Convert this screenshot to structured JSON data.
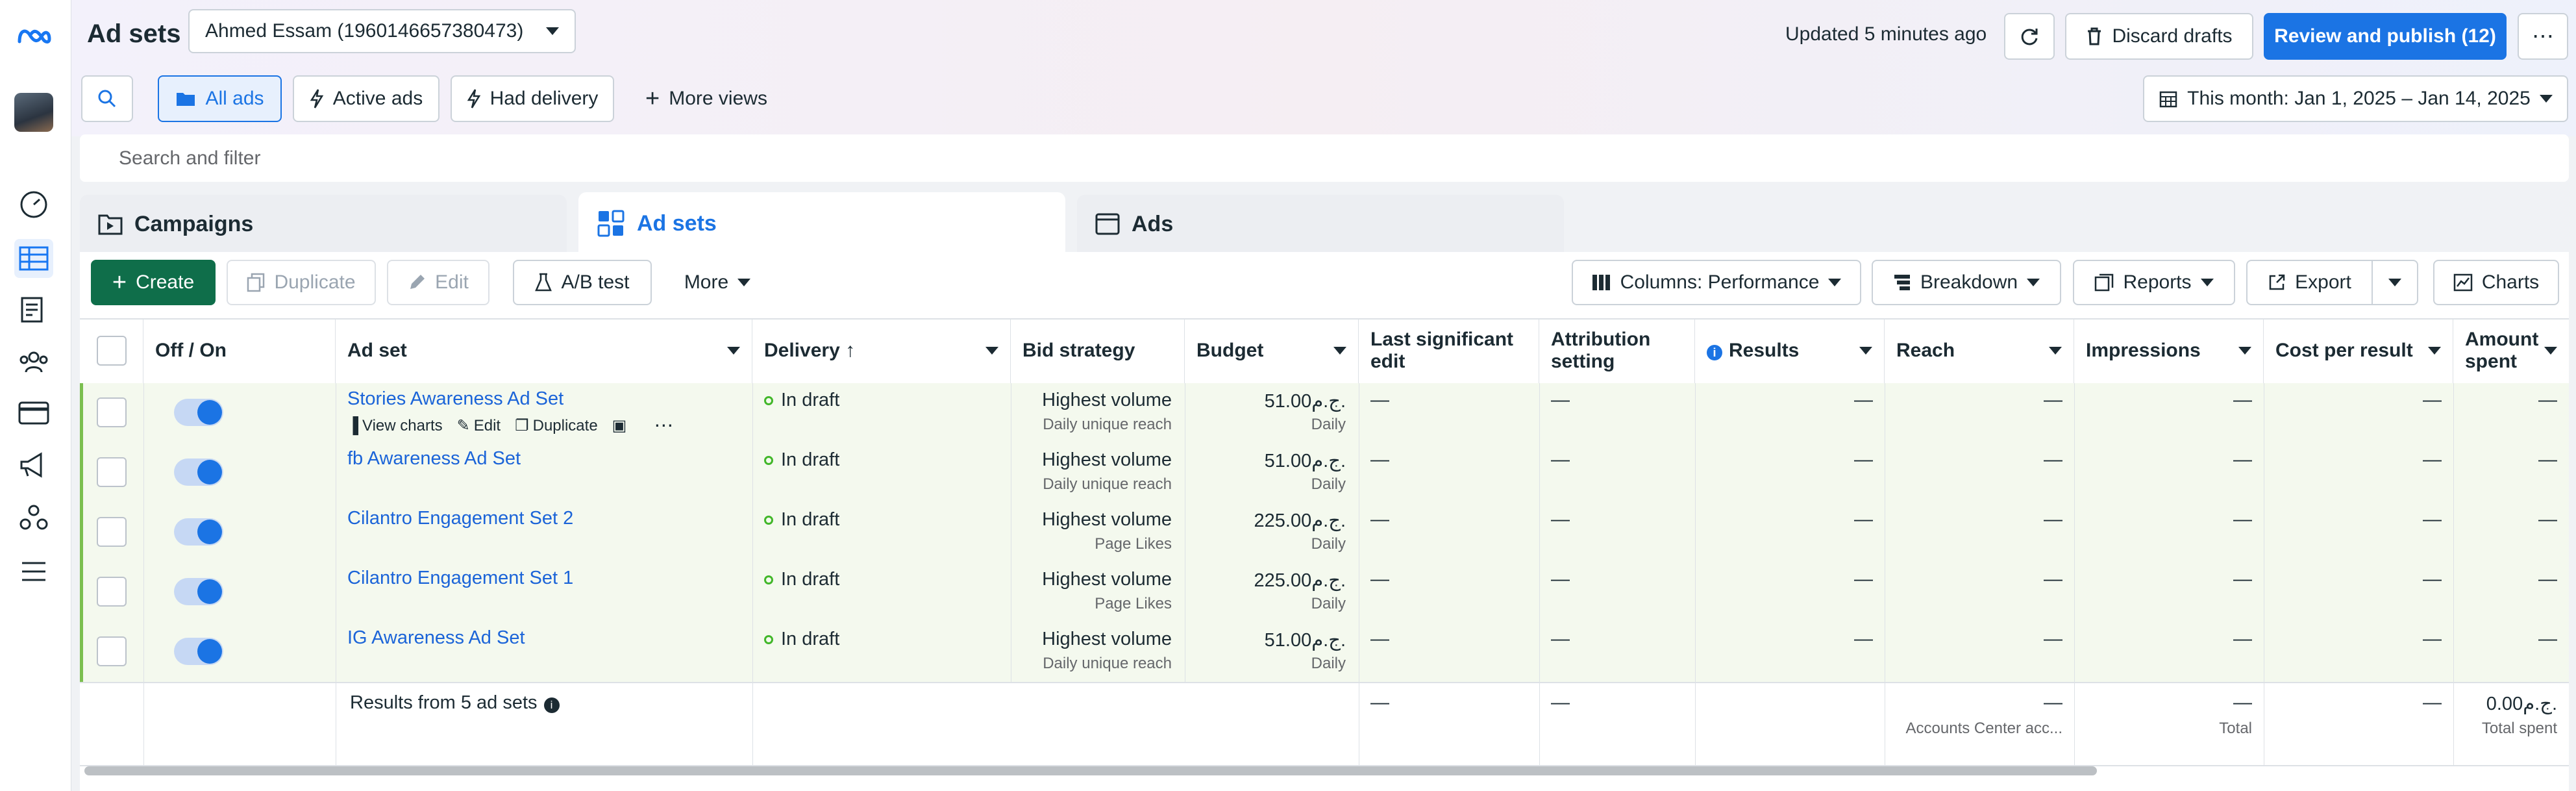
{
  "header": {
    "title": "Ad sets",
    "account": "Ahmed Essam (1960146657380473)",
    "updated": "Updated 5 minutes ago",
    "discard": "Discard drafts",
    "review": "Review and publish (12)",
    "more": "⋯"
  },
  "views": {
    "all": "All ads",
    "active": "Active ads",
    "delivery": "Had delivery",
    "more": "More views",
    "date": "This month: Jan 1, 2025 – Jan 14, 2025"
  },
  "search": {
    "placeholder": "Search and filter"
  },
  "tabs": {
    "campaigns": "Campaigns",
    "adsets": "Ad sets",
    "ads": "Ads"
  },
  "toolbar": {
    "create": "Create",
    "duplicate": "Duplicate",
    "edit": "Edit",
    "ab": "A/B test",
    "more": "More",
    "columns": "Columns: Performance",
    "breakdown": "Breakdown",
    "reports": "Reports",
    "export": "Export",
    "charts": "Charts"
  },
  "columns": {
    "onoff": "Off / On",
    "adset": "Ad set",
    "delivery": "Delivery ↑",
    "bid": "Bid strategy",
    "budget": "Budget",
    "last_edit": "Last significant edit",
    "attribution": "Attribution setting",
    "results": "Results",
    "reach": "Reach",
    "impressions": "Impressions",
    "cpr": "Cost per result",
    "spent": "Amount spent"
  },
  "row_actions": {
    "charts": "View charts",
    "edit": "Edit",
    "duplicate": "Duplicate"
  },
  "rows": [
    {
      "name": "Stories Awareness Ad Set",
      "delivery": "In draft",
      "bid": "Highest volume",
      "bid_sub": "Daily unique reach",
      "budget": "51.00ج.م.",
      "budget_sub": "Daily",
      "dash": "—"
    },
    {
      "name": "fb Awareness Ad Set",
      "delivery": "In draft",
      "bid": "Highest volume",
      "bid_sub": "Daily unique reach",
      "budget": "51.00ج.م.",
      "budget_sub": "Daily",
      "dash": "—"
    },
    {
      "name": "Cilantro Engagement Set 2",
      "delivery": "In draft",
      "bid": "Highest volume",
      "bid_sub": "Page Likes",
      "budget": "225.00ج.م.",
      "budget_sub": "Daily",
      "dash": "—"
    },
    {
      "name": "Cilantro Engagement Set 1",
      "delivery": "In draft",
      "bid": "Highest volume",
      "bid_sub": "Page Likes",
      "budget": "225.00ج.م.",
      "budget_sub": "Daily",
      "dash": "—"
    },
    {
      "name": "IG Awareness Ad Set",
      "delivery": "In draft",
      "bid": "Highest volume",
      "bid_sub": "Daily unique reach",
      "budget": "51.00ج.م.",
      "budget_sub": "Daily",
      "dash": "—"
    }
  ],
  "summary": {
    "label": "Results from 5 ad sets",
    "dash": "—",
    "reach_sub": "Accounts Center acc...",
    "impr_sub": "Total",
    "spent": "0.00ج.م.",
    "spent_sub": "Total spent"
  },
  "colors": {
    "accent": "#1b74e4",
    "create": "#0f6e4a",
    "draft_row": "#f4f9ee"
  }
}
